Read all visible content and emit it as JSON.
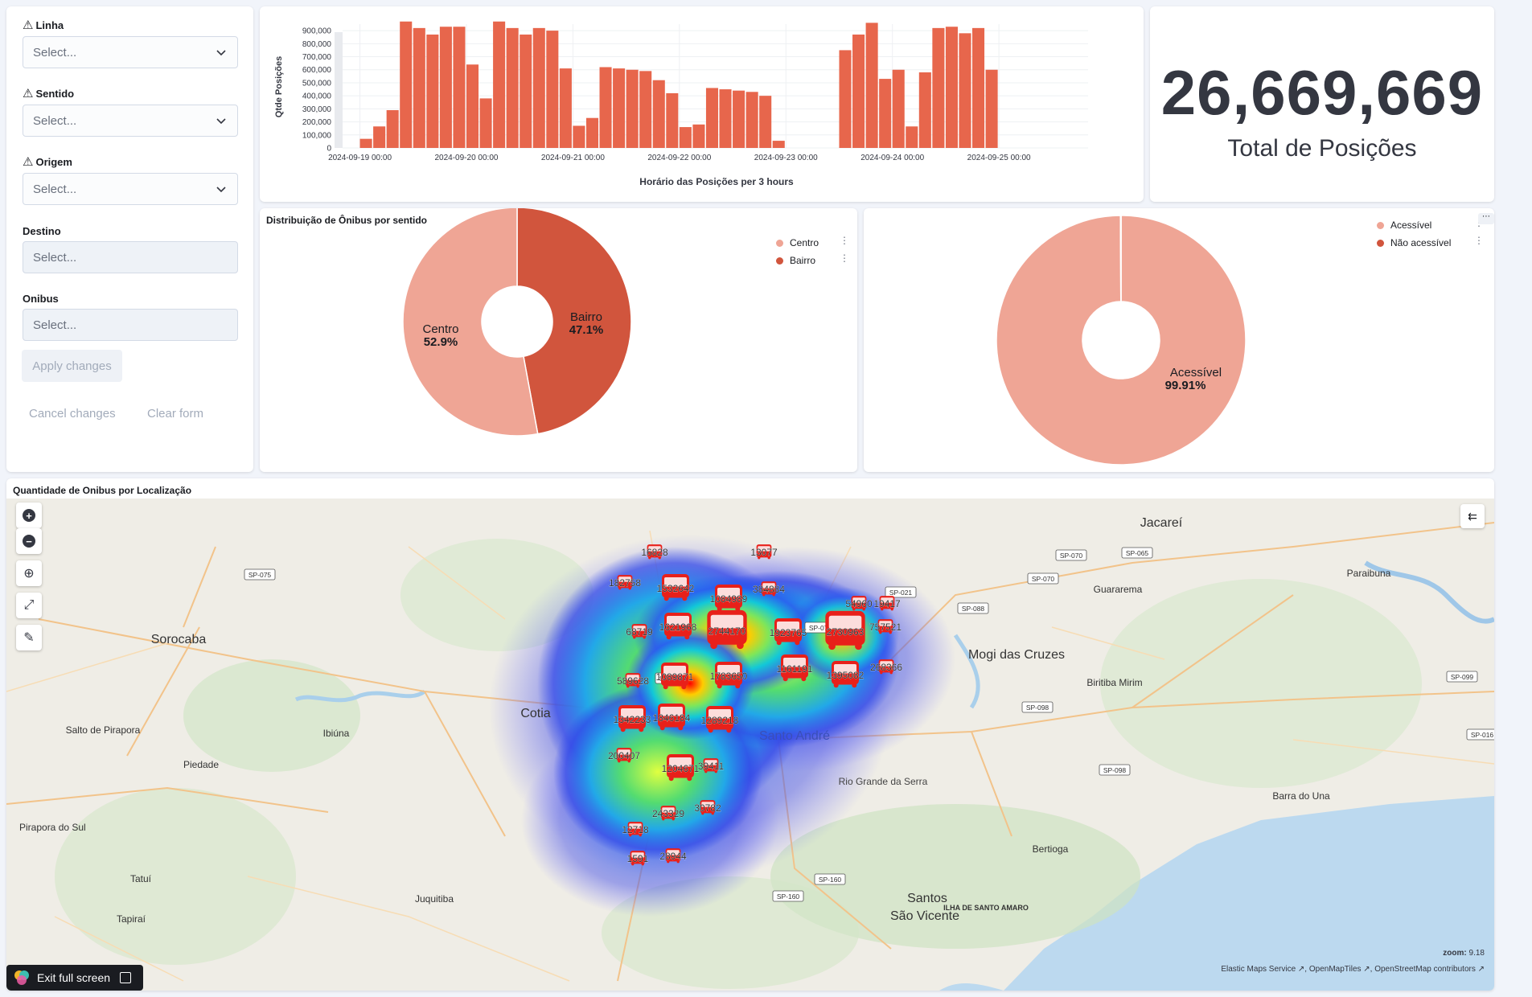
{
  "controls": {
    "fields": [
      {
        "label": "Linha",
        "placeholder": "Select...",
        "warning": true,
        "disabled": false
      },
      {
        "label": "Sentido",
        "placeholder": "Select...",
        "warning": true,
        "disabled": false
      },
      {
        "label": "Origem",
        "placeholder": "Select...",
        "warning": true,
        "disabled": false
      },
      {
        "label": "Destino",
        "placeholder": "Select...",
        "warning": false,
        "disabled": true
      },
      {
        "label": "Onibus",
        "placeholder": "Select...",
        "warning": false,
        "disabled": true
      }
    ],
    "apply_label": "Apply changes",
    "cancel_label": "Cancel changes",
    "clear_label": "Clear form"
  },
  "bar_chart": {
    "xlabel": "Horário das Posições per 3 hours",
    "ylabel": "Qtde Posições"
  },
  "chart_data": [
    {
      "type": "bar",
      "title": "",
      "xlabel": "Horário das Posições per 3 hours",
      "ylabel": "Qtde Posições",
      "ylim": [
        0,
        950000
      ],
      "yticks": [
        "0",
        "100,000",
        "200,000",
        "300,000",
        "400,000",
        "500,000",
        "600,000",
        "700,000",
        "800,000",
        "900,000"
      ],
      "xticks": [
        "2024-09-19 00:00",
        "2024-09-20 00:00",
        "2024-09-21 00:00",
        "2024-09-22 00:00",
        "2024-09-23 00:00",
        "2024-09-24 00:00",
        "2024-09-25 00:00"
      ],
      "color": "#e7664c",
      "series": [
        {
          "values": [
            70000,
            165000,
            290000,
            970000,
            920000,
            870000,
            930000,
            930000,
            640000,
            380000,
            970000,
            920000,
            870000,
            920000,
            900000,
            610000,
            170000,
            230000,
            620000,
            610000,
            600000,
            590000,
            520000,
            420000,
            160000,
            180000,
            460000,
            450000,
            440000,
            430000,
            400000,
            55000,
            0,
            0,
            0,
            0,
            750000,
            870000,
            960000,
            530000,
            600000,
            165000,
            580000,
            920000,
            930000,
            880000,
            920000,
            600000
          ]
        }
      ]
    },
    {
      "type": "pie",
      "title": "Distribuição de Ônibus por sentido",
      "categories": [
        "Centro",
        "Bairro"
      ],
      "values": [
        52.9,
        47.1
      ],
      "labels": [
        "52.9%",
        "47.1%"
      ],
      "colors": [
        "#efa595",
        "#d1553d"
      ],
      "legend": "top-right"
    },
    {
      "type": "pie",
      "title": "",
      "categories": [
        "Acessível",
        "Não acessível"
      ],
      "values": [
        99.91,
        0.09
      ],
      "labels": [
        "99.91%",
        ""
      ],
      "colors": [
        "#efa595",
        "#d1553d"
      ],
      "legend": "top-right"
    }
  ],
  "metric": {
    "value": "26,669,669",
    "label": "Total de Posições"
  },
  "pie1": {
    "title": "Distribuição de Ônibus por sentido",
    "legend": [
      "Centro",
      "Bairro"
    ],
    "slice_labels": [
      {
        "name": "Centro",
        "pct": "52.9%"
      },
      {
        "name": "Bairro",
        "pct": "47.1%"
      }
    ]
  },
  "pie2": {
    "legend": [
      "Acessível",
      "Não acessível"
    ],
    "slice_label": {
      "name": "Acessível",
      "pct": "99.91%"
    }
  },
  "map": {
    "title": "Quantidade de Onibus por Localização",
    "places": [
      {
        "name": "Sorocaba",
        "size": "big"
      },
      {
        "name": "Cotia",
        "size": "big"
      },
      {
        "name": "Mogi das Cruzes",
        "size": "big"
      },
      {
        "name": "Santo André",
        "size": "big"
      },
      {
        "name": "Santos",
        "size": "big"
      },
      {
        "name": "São Vicente",
        "size": "big"
      },
      {
        "name": "Jacareí",
        "size": "big"
      },
      {
        "name": "Salto de Pirapora",
        "size": "small"
      },
      {
        "name": "Ibiúna",
        "size": "small"
      },
      {
        "name": "Piedade",
        "size": "small"
      },
      {
        "name": "Tatuí",
        "size": "small"
      },
      {
        "name": "Juquitiba",
        "size": "small"
      },
      {
        "name": "Guararema",
        "size": "small"
      },
      {
        "name": "Biritiba Mirim",
        "size": "small"
      },
      {
        "name": "Paraibuna",
        "size": "small"
      },
      {
        "name": "Rio Grande da Serra",
        "size": "small"
      },
      {
        "name": "Barra do Una",
        "size": "small"
      },
      {
        "name": "Bertioga",
        "size": "small"
      },
      {
        "name": "ILHA DE SANTO AMARO",
        "size": "tiny"
      },
      {
        "name": "Tapiraí",
        "size": "small"
      },
      {
        "name": "Pirapora do Sul",
        "size": "small"
      }
    ],
    "roads": [
      "SP-075",
      "SP-070",
      "SP-065",
      "SP-070",
      "SP-021",
      "SP-088",
      "SP-070",
      "SP-015",
      "SP-099",
      "SP-098",
      "SP-098",
      "SP-160",
      "SP-160",
      "SP-016"
    ],
    "bus_markers": [
      {
        "label": "16828",
        "scale": "s"
      },
      {
        "label": "13077",
        "scale": "s"
      },
      {
        "label": "182758",
        "scale": "s"
      },
      {
        "label": "1532642",
        "scale": "m"
      },
      {
        "label": "1084989",
        "scale": "m"
      },
      {
        "label": "384884",
        "scale": "s"
      },
      {
        "label": "54960",
        "scale": "s"
      },
      {
        "label": "19417",
        "scale": "s"
      },
      {
        "label": "68719",
        "scale": "s"
      },
      {
        "label": "1621968",
        "scale": "m"
      },
      {
        "label": "2744170",
        "scale": "l"
      },
      {
        "label": "1923765",
        "scale": "m"
      },
      {
        "label": "2730963",
        "scale": "l"
      },
      {
        "label": "757521",
        "scale": "s"
      },
      {
        "label": "589628",
        "scale": "s"
      },
      {
        "label": "1089871",
        "scale": "m"
      },
      {
        "label": "1783650",
        "scale": "m"
      },
      {
        "label": "1161191",
        "scale": "m"
      },
      {
        "label": "1395082",
        "scale": "m"
      },
      {
        "label": "268366",
        "scale": "s"
      },
      {
        "label": "1342233",
        "scale": "m"
      },
      {
        "label": "1846184",
        "scale": "m"
      },
      {
        "label": "1289218",
        "scale": "m"
      },
      {
        "label": "200407",
        "scale": "s"
      },
      {
        "label": "1204671",
        "scale": "m"
      },
      {
        "label": "39411",
        "scale": "s"
      },
      {
        "label": "243329",
        "scale": "s"
      },
      {
        "label": "30782",
        "scale": "s"
      },
      {
        "label": "12718",
        "scale": "s"
      },
      {
        "label": "1591",
        "scale": "s"
      },
      {
        "label": "28944",
        "scale": "s"
      }
    ],
    "zoom_label": "zoom:",
    "zoom_value": "9.18",
    "attribution": "Elastic Maps Service ↗, OpenMapTiles ↗, OpenStreetMap contributors ↗",
    "exit_fullscreen": "Exit full screen"
  },
  "icons": {
    "warning": "warning-icon",
    "chevron": "chevron-down-icon",
    "zoom_in": "plus-icon",
    "zoom_out": "minus-icon"
  }
}
